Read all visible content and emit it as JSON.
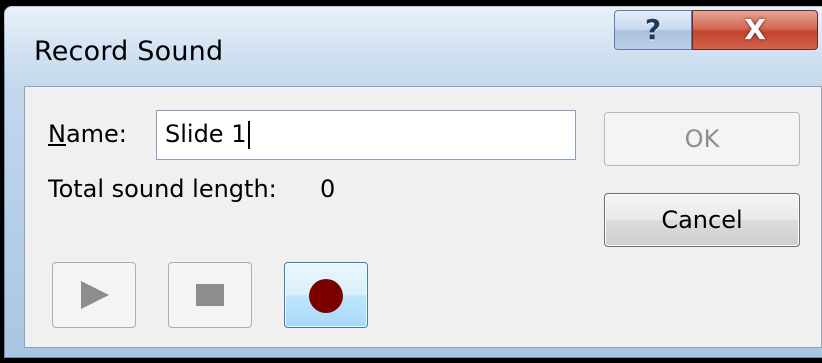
{
  "window": {
    "title": "Record Sound",
    "help_glyph": "?",
    "close_glyph": "X"
  },
  "form": {
    "name_label_accel": "N",
    "name_label_rest": "ame:",
    "name_value": "Slide 1",
    "length_label": "Total sound length:",
    "length_value": "0"
  },
  "buttons": {
    "ok_label": "OK",
    "ok_enabled": false,
    "cancel_label": "Cancel"
  },
  "controls": {
    "play_icon": "play-icon",
    "play_enabled": false,
    "stop_icon": "stop-icon",
    "stop_enabled": false,
    "record_icon": "record-icon",
    "record_color": "#7a0000"
  }
}
